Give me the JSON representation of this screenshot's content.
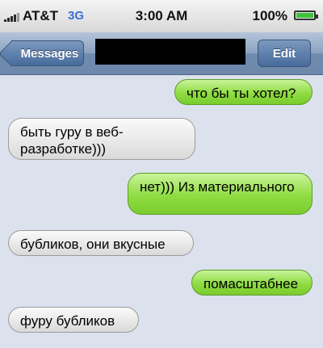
{
  "status_bar": {
    "carrier": "AT&T",
    "network": "3G",
    "time": "3:00 AM",
    "battery": "100%"
  },
  "nav": {
    "back_label": "Messages",
    "edit_label": "Edit"
  },
  "messages": [
    {
      "side": "sent",
      "text": "что бы ты хотел?"
    },
    {
      "side": "received",
      "text": "быть гуру в веб-разработке)))"
    },
    {
      "side": "sent",
      "text": "нет))) Из материального"
    },
    {
      "side": "received",
      "text": "бубликов, они вкусные"
    },
    {
      "side": "sent",
      "text": "помасштабнее"
    },
    {
      "side": "received",
      "text": "фуру бубликов"
    }
  ],
  "colors": {
    "sent_bubble": "#8fdc43",
    "received_bubble": "#e7e7e7",
    "nav_bar": "#8aa2c0",
    "background": "#dbe2ed"
  }
}
